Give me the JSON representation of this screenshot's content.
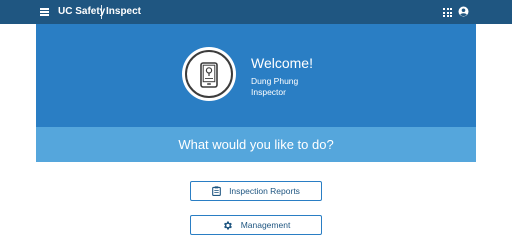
{
  "header": {
    "brand": "UC Safety",
    "app_name": "Inspect",
    "icons": [
      "menu-icon",
      "apps-grid-icon",
      "account-icon"
    ]
  },
  "welcome": {
    "title": "Welcome!",
    "user_name": "Dung Phung",
    "user_role": "Inspector",
    "avatar_icon": "tablet-inspect-icon"
  },
  "prompt": "What would you like to do?",
  "actions": [
    {
      "label": "Inspection Reports",
      "icon": "clipboard-icon"
    },
    {
      "label": "Management",
      "icon": "gear-icon"
    }
  ],
  "colors": {
    "topbar": "#1f5681",
    "hero": "#2a7ec4",
    "prompt_band": "#55a6dc",
    "button_text": "#1f5681"
  }
}
